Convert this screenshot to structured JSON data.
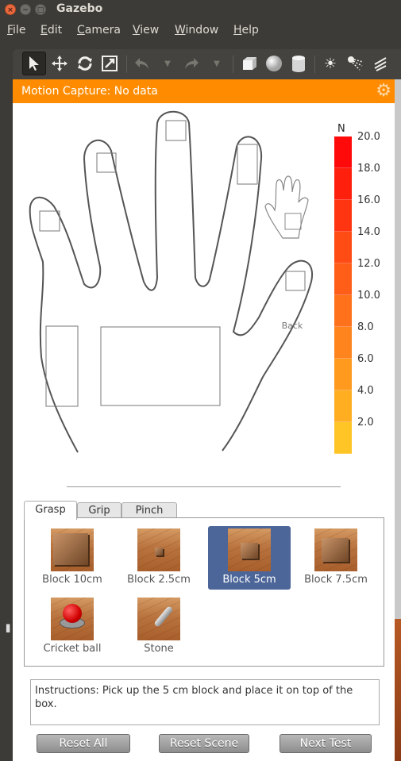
{
  "window": {
    "title": "Gazebo",
    "close_glyph": "×",
    "min_glyph": "−",
    "max_glyph": "□"
  },
  "menu": [
    "File",
    "Edit",
    "Camera",
    "View",
    "Window",
    "Help"
  ],
  "toolbar": {
    "tools": [
      "select-arrow-icon",
      "translate-icon",
      "rotate-icon",
      "scale-icon",
      "undo-icon",
      "undo-dropdown-icon",
      "redo-icon",
      "redo-dropdown-icon",
      "box-shape-icon",
      "sphere-shape-icon",
      "cylinder-shape-icon",
      "point-light-icon",
      "spot-light-icon",
      "directional-light-icon"
    ]
  },
  "mocap": {
    "status": "Motion Capture: No data"
  },
  "hand": {
    "back_label": "Back"
  },
  "scale": {
    "unit": "N",
    "ticks": [
      "20.0",
      "18.0",
      "16.0",
      "14.0",
      "12.0",
      "10.0",
      "8.0",
      "6.0",
      "4.0",
      "2.0"
    ],
    "colors": [
      "#ff0a0a",
      "#ff1f0d",
      "#ff3512",
      "#ff4b14",
      "#ff5e18",
      "#ff711a",
      "#ff841d",
      "#ff9a1f",
      "#ffae22",
      "#ffc426"
    ]
  },
  "tabs": [
    "Grasp",
    "Grip",
    "Pinch"
  ],
  "selected_tab": "Grasp",
  "objects": [
    {
      "label": "Block 10cm"
    },
    {
      "label": "Block 2.5cm"
    },
    {
      "label": "Block 5cm"
    },
    {
      "label": "Block 7.5cm"
    },
    {
      "label": "Cricket ball"
    },
    {
      "label": "Stone"
    }
  ],
  "selected_object": "Block 5cm",
  "instructions": "Instructions: Pick up the 5 cm block and place it on top of the box.",
  "buttons": {
    "reset_all": "Reset All",
    "reset_scene": "Reset Scene",
    "next_test": "Next Test"
  }
}
